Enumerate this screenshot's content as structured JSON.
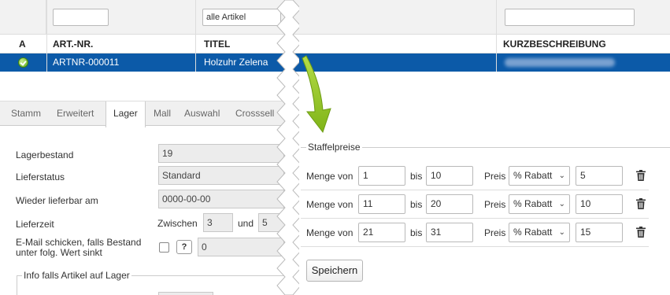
{
  "grid": {
    "filter_select_value": "alle Artikel",
    "headers": {
      "a": "A",
      "art_nr": "ART.-NR.",
      "titel": "TITEL",
      "kurzbeschreibung": "KURZBESCHREIBUNG"
    },
    "row": {
      "art_nr": "ARTNR-000011",
      "titel": "Holzuhr Zelena",
      "status_icon": "check-circle-icon"
    }
  },
  "tabs": [
    "Stamm",
    "Erweitert",
    "Lager",
    "Mall",
    "Auswahl",
    "Crosssell"
  ],
  "active_tab": "Lager",
  "lager": {
    "lagerbestand_label": "Lagerbestand",
    "lagerbestand_value": "19",
    "lieferstatus_label": "Lieferstatus",
    "lieferstatus_value": "Standard",
    "wieder_label": "Wieder lieferbar am",
    "wieder_value": "0000-00-00",
    "lieferzeit_label": "Lieferzeit",
    "zwischen_label": "Zwischen",
    "lieferzeit_from": "3",
    "und_label": "und",
    "lieferzeit_to": "5",
    "email_label_line1": "E-Mail schicken, falls Bestand",
    "email_label_line2": "unter folg. Wert sinkt",
    "help_label": "?",
    "email_value": "0",
    "info_legend": "Info falls Artikel auf Lager"
  },
  "staffel": {
    "legend": "Staffelpreise",
    "menge_label": "Menge von",
    "bis_label": "bis",
    "preis_label": "Preis",
    "rows": [
      {
        "from": "1",
        "to": "10",
        "type": "% Rabatt",
        "value": "5"
      },
      {
        "from": "11",
        "to": "20",
        "type": "% Rabatt",
        "value": "10"
      },
      {
        "from": "21",
        "to": "31",
        "type": "% Rabatt",
        "value": "15"
      }
    ],
    "save_label": "Speichern"
  },
  "colors": {
    "selection": "#0c5aa8",
    "arrow": "#8dc21f",
    "status_green": "#5aa917"
  }
}
